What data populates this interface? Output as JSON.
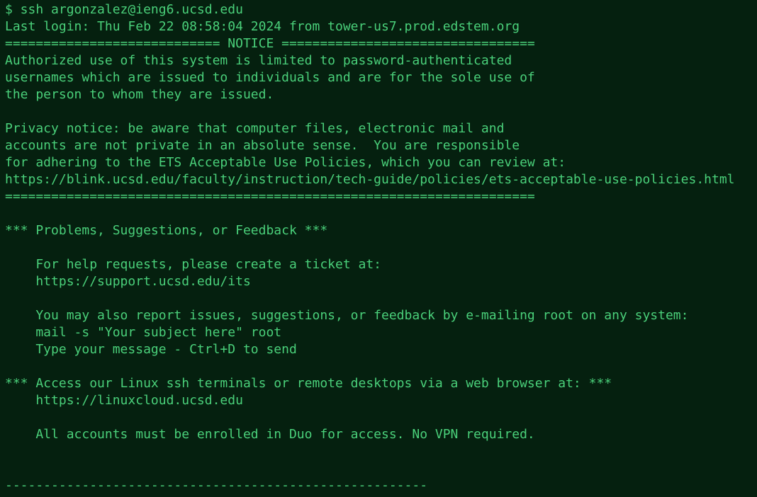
{
  "terminal": {
    "lines": [
      "$ ssh argonzalez@ieng6.ucsd.edu",
      "Last login: Thu Feb 22 08:58:04 2024 from tower-us7.prod.edstem.org",
      "============================ NOTICE =================================",
      "Authorized use of this system is limited to password-authenticated",
      "usernames which are issued to individuals and are for the sole use of",
      "the person to whom they are issued.",
      "",
      "Privacy notice: be aware that computer files, electronic mail and",
      "accounts are not private in an absolute sense.  You are responsible",
      "for adhering to the ETS Acceptable Use Policies, which you can review at:",
      "https://blink.ucsd.edu/faculty/instruction/tech-guide/policies/ets-acceptable-use-policies.html",
      "=====================================================================",
      "",
      "*** Problems, Suggestions, or Feedback ***",
      "",
      "    For help requests, please create a ticket at:",
      "    https://support.ucsd.edu/its",
      "",
      "    You may also report issues, suggestions, or feedback by e-mailing root on any system:",
      "    mail -s \"Your subject here\" root",
      "    Type your message - Ctrl+D to send",
      "",
      "*** Access our Linux ssh terminals or remote desktops via a web browser at: ***",
      "    https://linuxcloud.ucsd.edu",
      "",
      "    All accounts must be enrolled in Duo for access. No VPN required.",
      "",
      "",
      "-------------------------------------------------------"
    ]
  }
}
